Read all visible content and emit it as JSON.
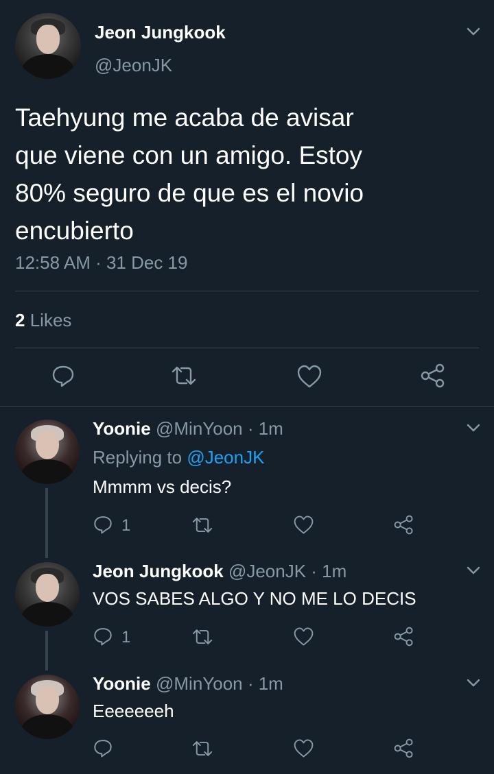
{
  "main_tweet": {
    "author_name": "Jeon Jungkook",
    "author_handle": "@JeonJK",
    "text_lines": [
      "Taehyung me acaba de avisar",
      "que viene con un amigo. Estoy",
      "80% seguro de que es el novio",
      "encubierto"
    ],
    "timestamp": "12:58 AM · 31 Dec 19",
    "likes_count": "2",
    "likes_label": "Likes"
  },
  "replies": [
    {
      "author_name": "Yoonie",
      "author_meta": "@MinYoon · 1m",
      "replying_prefix": "Replying to",
      "replying_handle": "@JeonJK",
      "text": "Mmmm vs decis?",
      "reply_count": "1"
    },
    {
      "author_name": "Jeon Jungkook",
      "author_meta": "@JeonJK · 1m",
      "text": "VOS SABES ALGO Y NO ME LO DECIS",
      "reply_count": "1"
    },
    {
      "author_name": "Yoonie",
      "author_meta": "@MinYoon · 1m",
      "text": "Eeeeeeeh",
      "reply_count": ""
    }
  ],
  "icons": [
    "chevron-down-icon",
    "reply-icon",
    "retweet-icon",
    "like-icon",
    "share-icon"
  ],
  "colors": {
    "background": "#15202b",
    "text": "#ffffff",
    "muted": "#8899a6",
    "link": "#1da1f2",
    "divider": "#38444d"
  }
}
